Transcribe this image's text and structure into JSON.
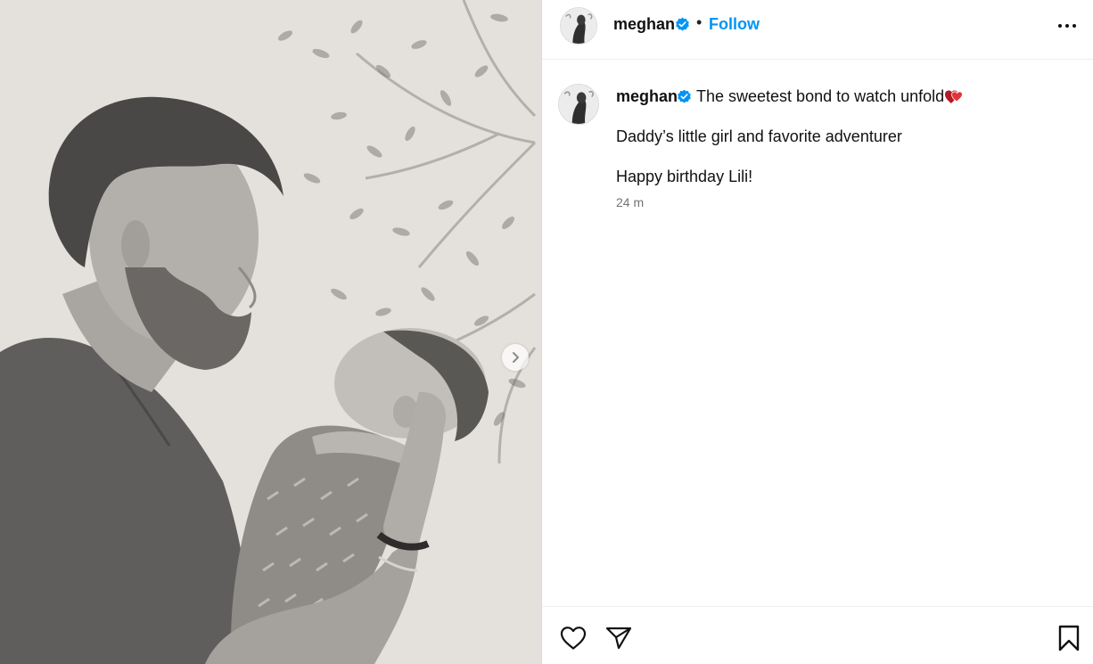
{
  "post": {
    "author": {
      "username": "meghan",
      "verified": true,
      "follow_label": "Follow",
      "separator": "•"
    },
    "caption": {
      "line1": "The sweetest bond to watch unfold",
      "line1_emoji": "two-hearts",
      "line2": "Daddy’s little girl and favorite adventurer",
      "line3": "Happy birthday Lili!",
      "timestamp": "24 m"
    },
    "media": {
      "description_icon": "photo-carousel",
      "next_icon": "chevron-right-icon"
    },
    "icons": {
      "more": "more-options-icon",
      "like": "heart-outline-icon",
      "share": "paper-plane-icon",
      "save": "bookmark-icon"
    },
    "colors": {
      "accent": "#0095f6",
      "verified_badge": "#0095f6",
      "emoji_heart": "#d8202b",
      "muted_text": "#737373"
    }
  }
}
